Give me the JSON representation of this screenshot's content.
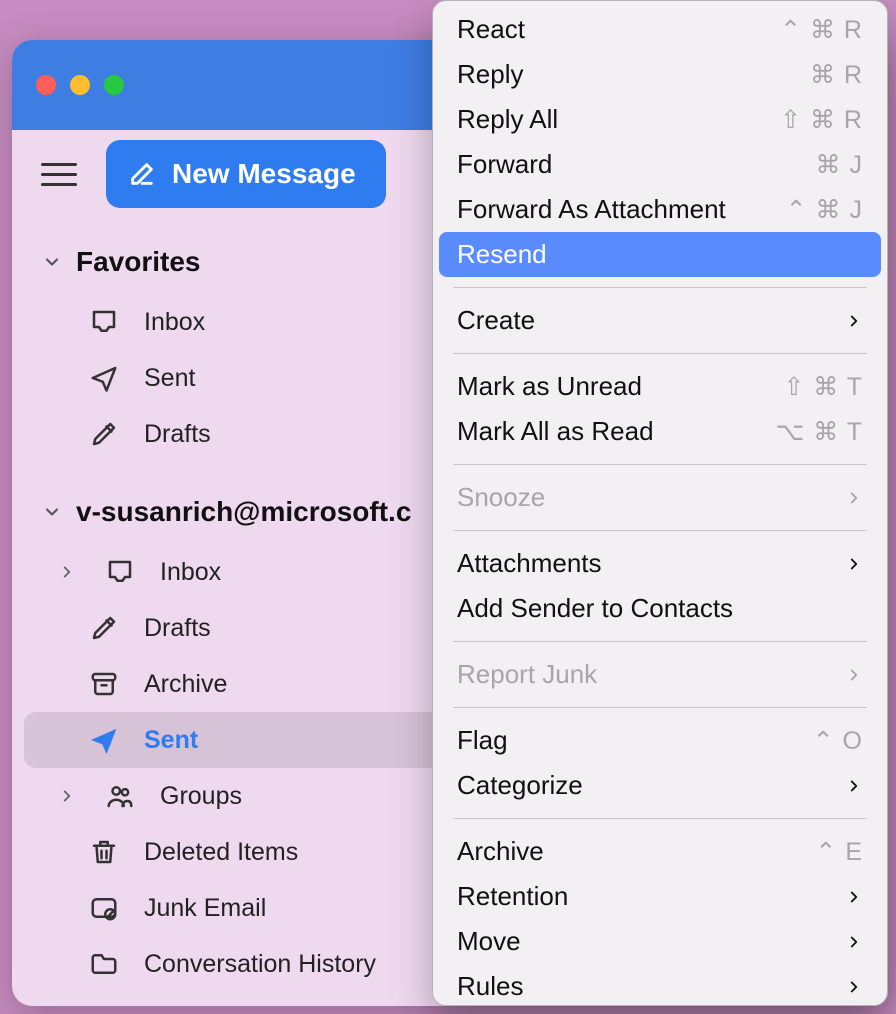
{
  "toolbar": {
    "new_message": "New Message"
  },
  "sidebar": {
    "favorites_label": "Favorites",
    "favorites": [
      {
        "label": "Inbox"
      },
      {
        "label": "Sent"
      },
      {
        "label": "Drafts"
      }
    ],
    "account_label": "v-susanrich@microsoft.c",
    "folders": [
      {
        "label": "Inbox"
      },
      {
        "label": "Drafts"
      },
      {
        "label": "Archive"
      },
      {
        "label": "Sent"
      },
      {
        "label": "Groups"
      },
      {
        "label": "Deleted Items"
      },
      {
        "label": "Junk Email"
      },
      {
        "label": "Conversation History"
      }
    ]
  },
  "context_menu": {
    "react": "React",
    "reply": "Reply",
    "reply_all": "Reply All",
    "forward": "Forward",
    "forward_attach": "Forward As Attachment",
    "resend": "Resend",
    "create": "Create",
    "mark_unread": "Mark as Unread",
    "mark_all_read": "Mark All as Read",
    "snooze": "Snooze",
    "attachments": "Attachments",
    "add_sender": "Add Sender to Contacts",
    "report_junk": "Report Junk",
    "flag": "Flag",
    "categorize": "Categorize",
    "archive": "Archive",
    "retention": "Retention",
    "move": "Move",
    "rules": "Rules",
    "sc_react": "⌃ ⌘ R",
    "sc_reply": "⌘ R",
    "sc_reply_all": "⇧ ⌘ R",
    "sc_forward": "⌘ J",
    "sc_forward_attach": "⌃ ⌘ J",
    "sc_mark_unread": "⇧ ⌘ T",
    "sc_mark_all_read": "⌥ ⌘ T",
    "sc_flag": "⌃ O",
    "sc_archive": "⌃ E"
  }
}
